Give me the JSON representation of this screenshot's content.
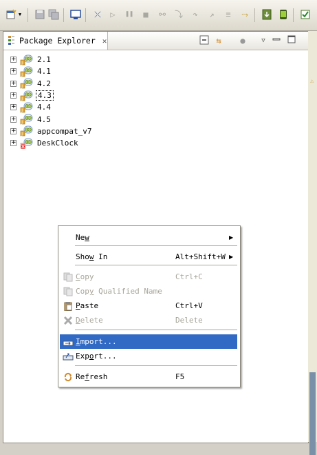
{
  "toolbar": {
    "icons": [
      "new-wizard-icon",
      "dropdown-icon",
      "save-icon",
      "save-all-icon",
      "console-icon",
      "skip-breakpoints-icon",
      "resume-icon",
      "suspend-icon",
      "terminate-icon",
      "disconnect-icon",
      "step-into-icon",
      "step-over-icon",
      "step-return-icon",
      "drop-to-frame-icon",
      "use-step-filters-icon",
      "android-sdk-manager-icon",
      "avd-manager-icon",
      "lint-icon"
    ]
  },
  "view": {
    "title": "Package Explorer",
    "close_glyph": "✕",
    "header_buttons": [
      "collapse-all-icon",
      "link-with-editor-icon",
      "focus-task-icon",
      "view-menu-icon",
      "minimize-icon",
      "maximize-icon"
    ]
  },
  "tree": {
    "items": [
      {
        "label": "2.1",
        "icon": "android-project-icon",
        "focused": false,
        "error": false
      },
      {
        "label": "4.1",
        "icon": "android-project-icon",
        "focused": false,
        "error": false
      },
      {
        "label": "4.2",
        "icon": "android-project-icon",
        "focused": false,
        "error": false
      },
      {
        "label": "4.3",
        "icon": "android-project-icon",
        "focused": true,
        "error": false
      },
      {
        "label": "4.4",
        "icon": "android-project-icon",
        "focused": false,
        "error": false
      },
      {
        "label": "4.5",
        "icon": "android-project-icon",
        "focused": false,
        "error": false
      },
      {
        "label": "appcompat_v7",
        "icon": "android-project-icon",
        "focused": false,
        "error": false
      },
      {
        "label": "DeskClock",
        "icon": "android-project-error-icon",
        "focused": false,
        "error": true
      }
    ]
  },
  "context_menu": {
    "items": [
      {
        "id": "new",
        "pre": "Ne",
        "mn": "w",
        "post": "",
        "accel": "",
        "submenu": true,
        "disabled": false,
        "icon": "",
        "selected": false
      },
      {
        "id": "show-in",
        "pre": "Sho",
        "mn": "w",
        "post": " In",
        "accel": "Alt+Shift+W",
        "submenu": true,
        "disabled": false,
        "icon": "",
        "selected": false
      },
      {
        "id": "copy",
        "pre": "",
        "mn": "C",
        "post": "opy",
        "accel": "Ctrl+C",
        "submenu": false,
        "disabled": true,
        "icon": "copy-icon",
        "selected": false
      },
      {
        "id": "copy-qualified-name",
        "pre": "Cop",
        "mn": "y",
        "post": " Qualified Name",
        "accel": "",
        "submenu": false,
        "disabled": true,
        "icon": "copy-qualified-name-icon",
        "selected": false
      },
      {
        "id": "paste",
        "pre": "",
        "mn": "P",
        "post": "aste",
        "accel": "Ctrl+V",
        "submenu": false,
        "disabled": false,
        "icon": "paste-icon",
        "selected": false
      },
      {
        "id": "delete",
        "pre": "",
        "mn": "D",
        "post": "elete",
        "accel": "Delete",
        "submenu": false,
        "disabled": true,
        "icon": "delete-icon",
        "selected": false
      },
      {
        "id": "import",
        "pre": "",
        "mn": "I",
        "post": "mport...",
        "accel": "",
        "submenu": false,
        "disabled": false,
        "icon": "import-icon",
        "selected": true
      },
      {
        "id": "export",
        "pre": "Exp",
        "mn": "o",
        "post": "rt...",
        "accel": "",
        "submenu": false,
        "disabled": false,
        "icon": "export-icon",
        "selected": false
      },
      {
        "id": "refresh",
        "pre": "Re",
        "mn": "f",
        "post": "resh",
        "accel": "F5",
        "submenu": false,
        "disabled": false,
        "icon": "refresh-icon",
        "selected": false
      }
    ],
    "submenu_arrow": "▶"
  },
  "colors": {
    "selection": "#316ac5",
    "disabled_text": "#a7a59a",
    "android_green": "#7ab800"
  }
}
